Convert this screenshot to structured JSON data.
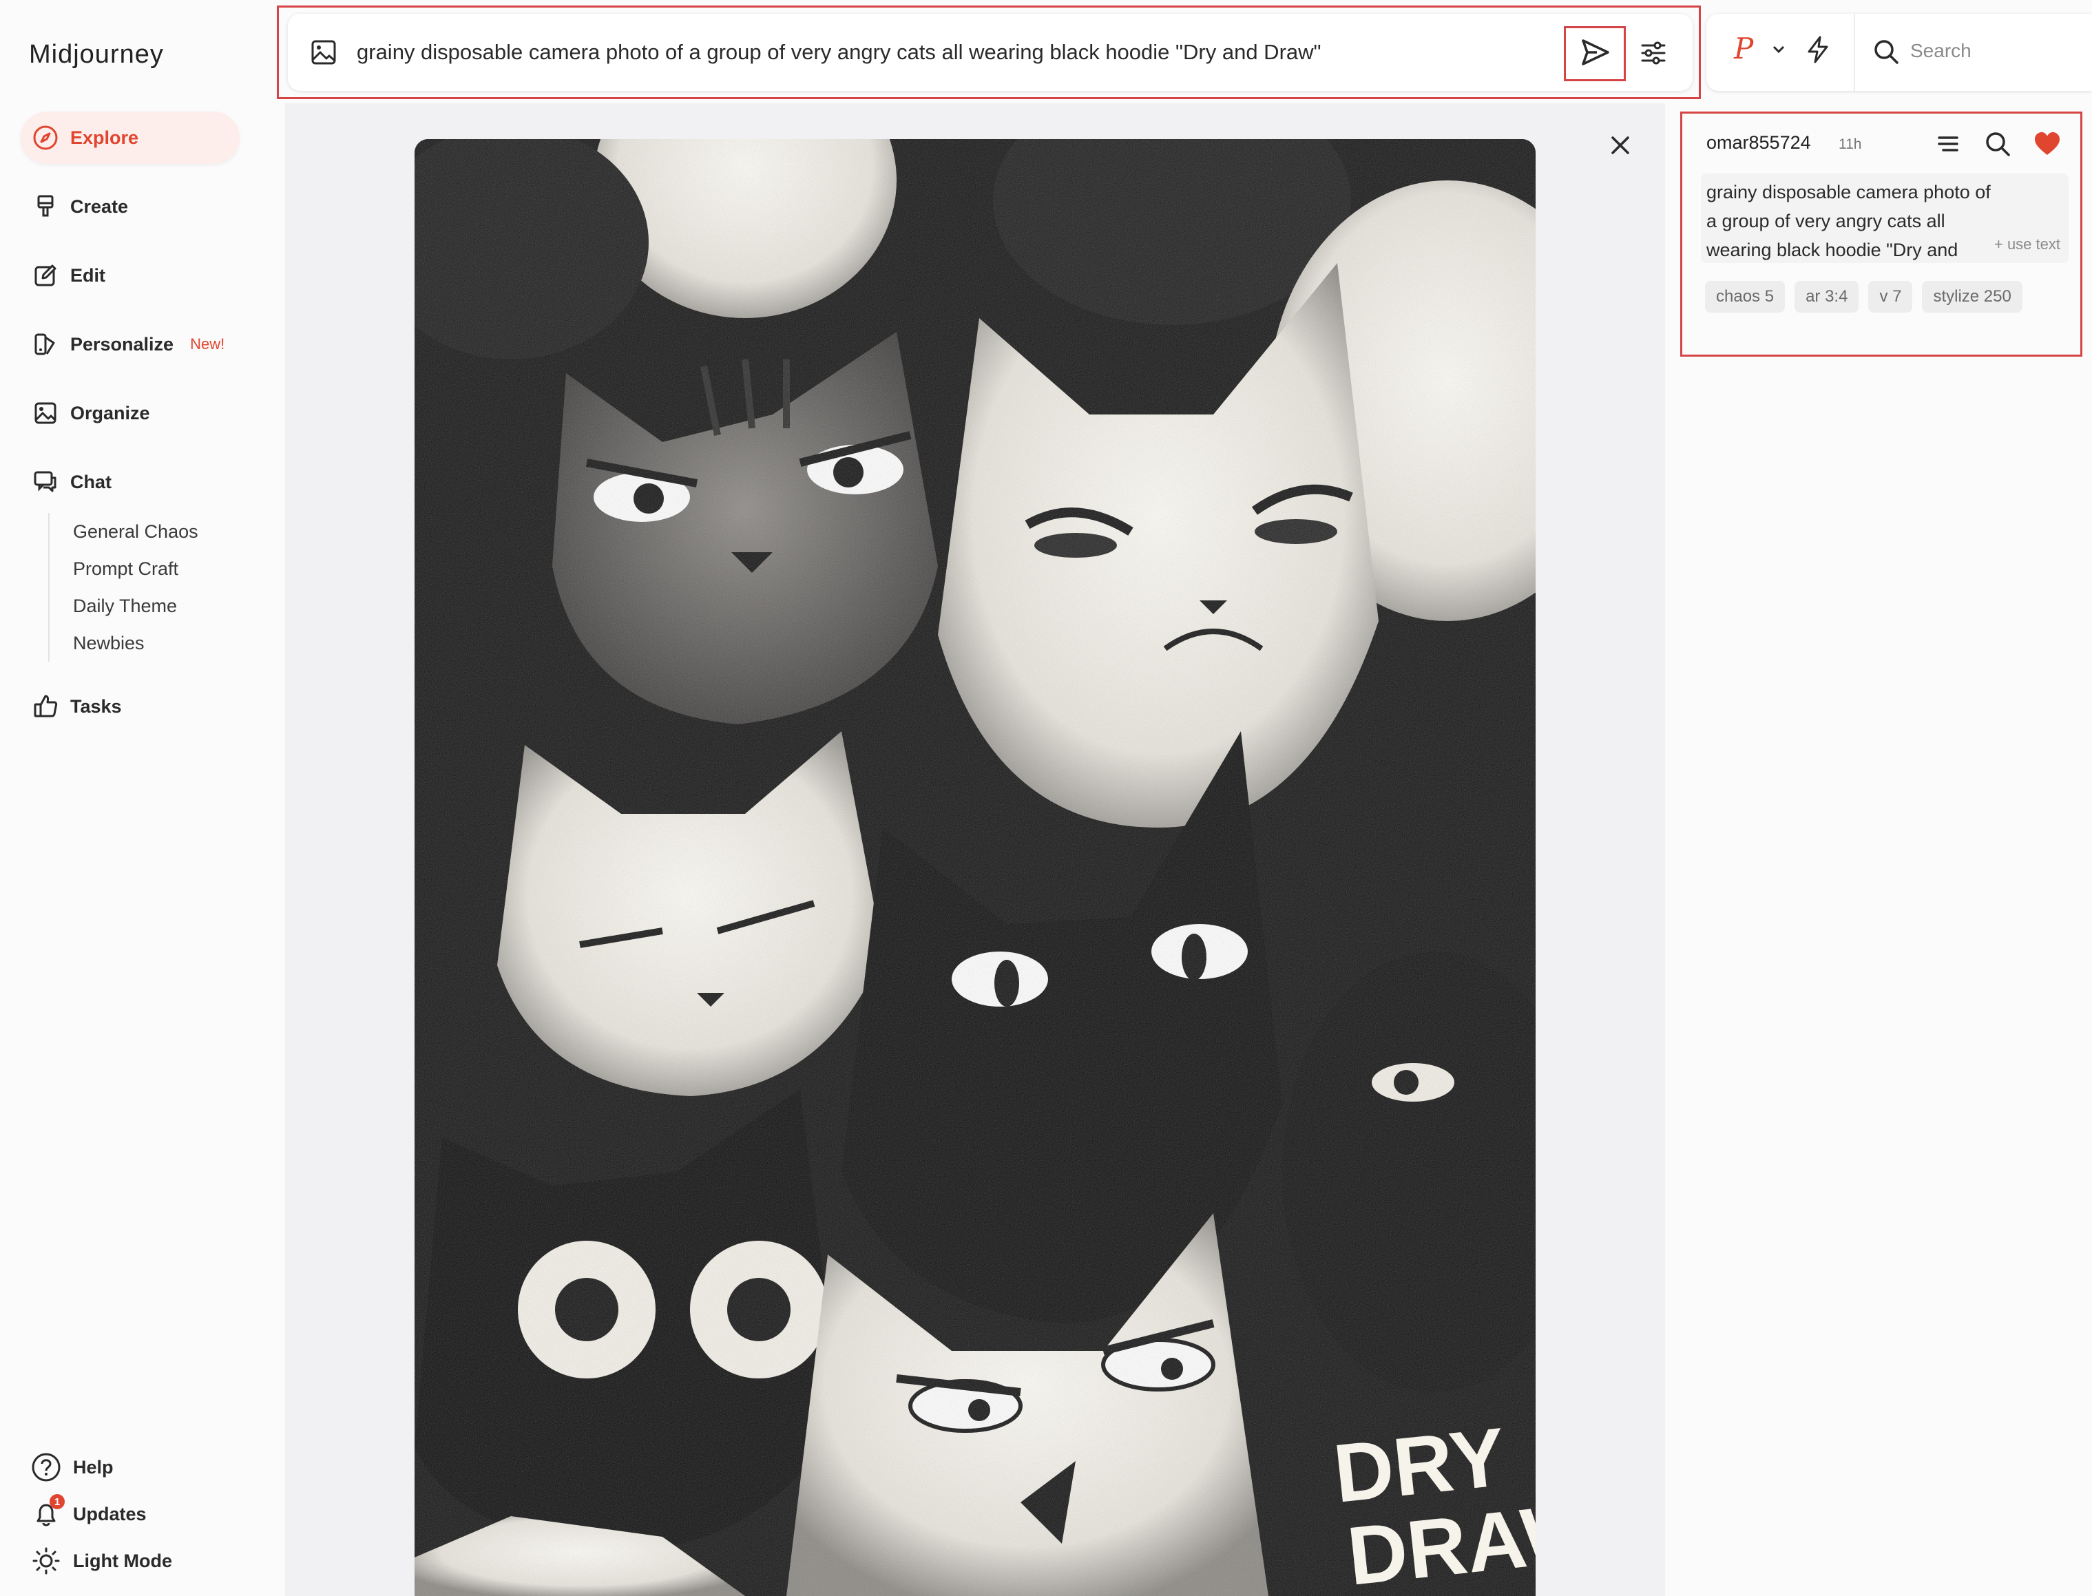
{
  "app": {
    "brand": "Midjourney"
  },
  "sidebar": {
    "items": [
      {
        "label": "Explore",
        "icon": "compass-icon"
      },
      {
        "label": "Create",
        "icon": "paintbrush-icon"
      },
      {
        "label": "Edit",
        "icon": "edit-icon"
      },
      {
        "label": "Personalize",
        "icon": "personalize-icon",
        "badge": "New!"
      },
      {
        "label": "Organize",
        "icon": "gallery-icon"
      },
      {
        "label": "Chat",
        "icon": "chat-icon"
      },
      {
        "label": "Tasks",
        "icon": "thumbs-up-icon"
      }
    ],
    "chat_channels": [
      "General Chaos",
      "Prompt Craft",
      "Daily Theme",
      "Newbies"
    ],
    "bottom": [
      {
        "label": "Help",
        "icon": "help-icon"
      },
      {
        "label": "Updates",
        "icon": "bell-icon",
        "count": "1"
      },
      {
        "label": "Light Mode",
        "icon": "sun-icon"
      }
    ]
  },
  "prompt_bar": {
    "text": "grainy disposable camera photo of a group of very angry cats all wearing black hoodie \"Dry and Draw\""
  },
  "top_right": {
    "logo": "P",
    "search_placeholder": "Search"
  },
  "artwork": {
    "text_line1": "DRY",
    "text_line2": "DRAW"
  },
  "info": {
    "username": "omar855724",
    "age": "11h",
    "prompt": "grainy disposable camera photo of a group of very angry cats all wearing black hoodie \"Dry and Draw\"",
    "use_text": "+ use text",
    "tags": [
      "chaos 5",
      "ar 3:4",
      "v 7",
      "stylize 250"
    ]
  },
  "colors": {
    "accent": "#e0452f",
    "highlight_border": "#d64545"
  }
}
